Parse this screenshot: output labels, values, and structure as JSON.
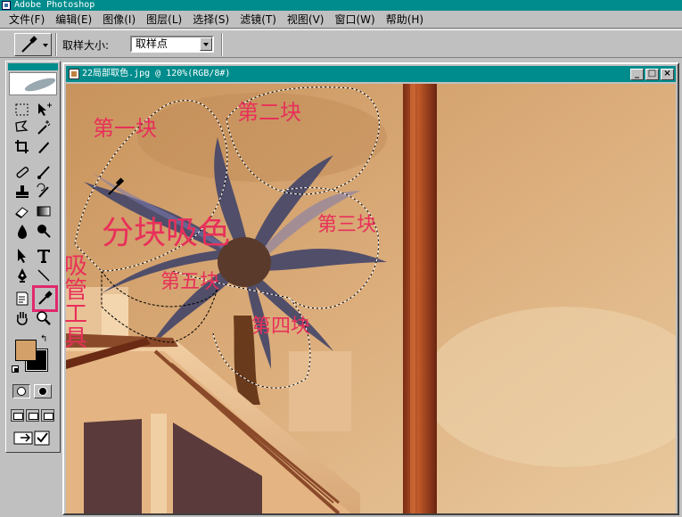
{
  "app": {
    "title": "Adobe Photoshop"
  },
  "menu": [
    "文件(F)",
    "编辑(E)",
    "图像(I)",
    "图层(L)",
    "选择(S)",
    "滤镜(T)",
    "视图(V)",
    "窗口(W)",
    "帮助(H)"
  ],
  "options": {
    "sample_size_label": "取样大小:",
    "sample_size_value": "取样点"
  },
  "document": {
    "title": "22局部取色.jpg @ 120%(RGB/8#)"
  },
  "annotations": {
    "block1": "第一块",
    "block2": "第二块",
    "block3": "第三块",
    "block4": "第四块",
    "block5": "第五块",
    "main_note": "分块吸色",
    "tool_note": [
      "吸",
      "管",
      "工",
      "具"
    ]
  },
  "colors": {
    "foreground": "#d4a06a",
    "background": "#000000",
    "title_bar": "#008c8c",
    "annotation": "#e8305a",
    "highlight_box": "#e0286c"
  },
  "icons": [
    "marquee-icon",
    "move-icon",
    "lasso-icon",
    "magic-wand-icon",
    "crop-icon",
    "slice-icon",
    "healing-brush-icon",
    "brush-icon",
    "stamp-icon",
    "history-brush-icon",
    "eraser-icon",
    "gradient-icon",
    "blur-icon",
    "dodge-icon",
    "path-select-icon",
    "type-icon",
    "pen-icon",
    "line-icon",
    "notes-icon",
    "eyedropper-icon",
    "hand-icon",
    "zoom-icon"
  ]
}
